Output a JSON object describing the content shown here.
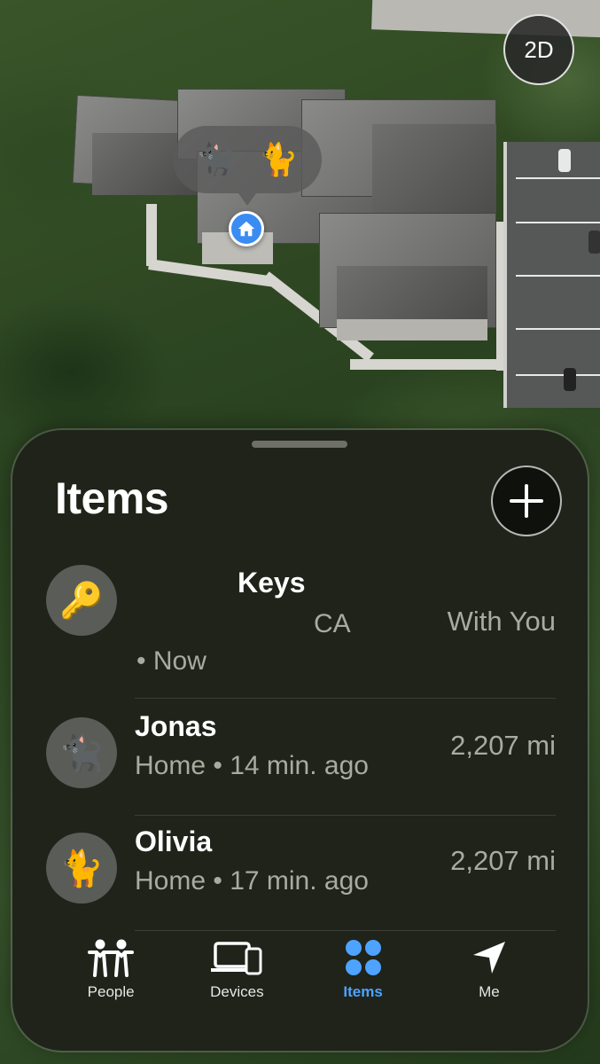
{
  "map": {
    "view_toggle": "2D",
    "pet_bubble": [
      "🐈‍⬛",
      "🐈"
    ]
  },
  "sheet": {
    "title": "Items",
    "items": [
      {
        "emoji": "🔑",
        "name": "Keys",
        "location": "CA",
        "time": "• Now",
        "distance": "With You"
      },
      {
        "emoji": "🐈‍⬛",
        "name": "Jonas",
        "subtitle": "Home • 14 min. ago",
        "distance": "2,207 mi"
      },
      {
        "emoji": "🐈",
        "name": "Olivia",
        "subtitle": "Home • 17 min. ago",
        "distance": "2,207 mi"
      }
    ]
  },
  "tabs": [
    {
      "label": "People",
      "icon": "people-icon"
    },
    {
      "label": "Devices",
      "icon": "devices-icon"
    },
    {
      "label": "Items",
      "icon": "items-icon",
      "active": true
    },
    {
      "label": "Me",
      "icon": "location-arrow-icon"
    }
  ],
  "colors": {
    "accent": "#4ea3ff",
    "pin": "#3a8cf2"
  }
}
